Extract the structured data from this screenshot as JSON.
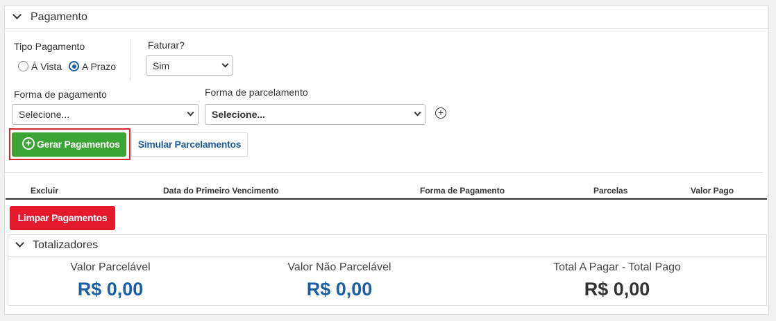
{
  "payment_panel": {
    "title": "Pagamento",
    "tipo_pagamento": {
      "label": "Tipo Pagamento",
      "options": [
        {
          "label": "À Vista",
          "checked": false
        },
        {
          "label": "A Prazo",
          "checked": true
        }
      ]
    },
    "faturar": {
      "label": "Faturar?",
      "selected": "Sim"
    },
    "forma_pagamento": {
      "label": "Forma de pagamento",
      "selected": "Selecione..."
    },
    "forma_parcelamento": {
      "label": "Forma de parcelamento",
      "selected": "Selecione..."
    },
    "add_icon": "plus-circle-icon",
    "buttons": {
      "gerar_pagamentos": "Gerar Pagamentos",
      "simular_parcelamentos": "Simular Parcelamentos",
      "limpar_pagamentos": "Limpar Pagamentos"
    },
    "table": {
      "columns": [
        "Excluir",
        "Data do Primeiro Vencimento",
        "Forma de Pagamento",
        "Parcelas",
        "Valor Pago"
      ],
      "rows": []
    }
  },
  "totalizadores": {
    "title": "Totalizadores",
    "items": [
      {
        "label": "Valor Parcelável",
        "value": "R$ 0,00"
      },
      {
        "label": "Valor Não Parcelável",
        "value": "R$ 0,00"
      },
      {
        "label": "Total A Pagar - Total Pago",
        "value": "R$ 0,00"
      }
    ]
  },
  "colors": {
    "green_button": "#3aa535",
    "red_button": "#e4192b",
    "link_blue": "#1f5c99",
    "value_blue": "#1a5fa5",
    "value_dark": "#333333",
    "focus_outline": "#d7262c"
  }
}
